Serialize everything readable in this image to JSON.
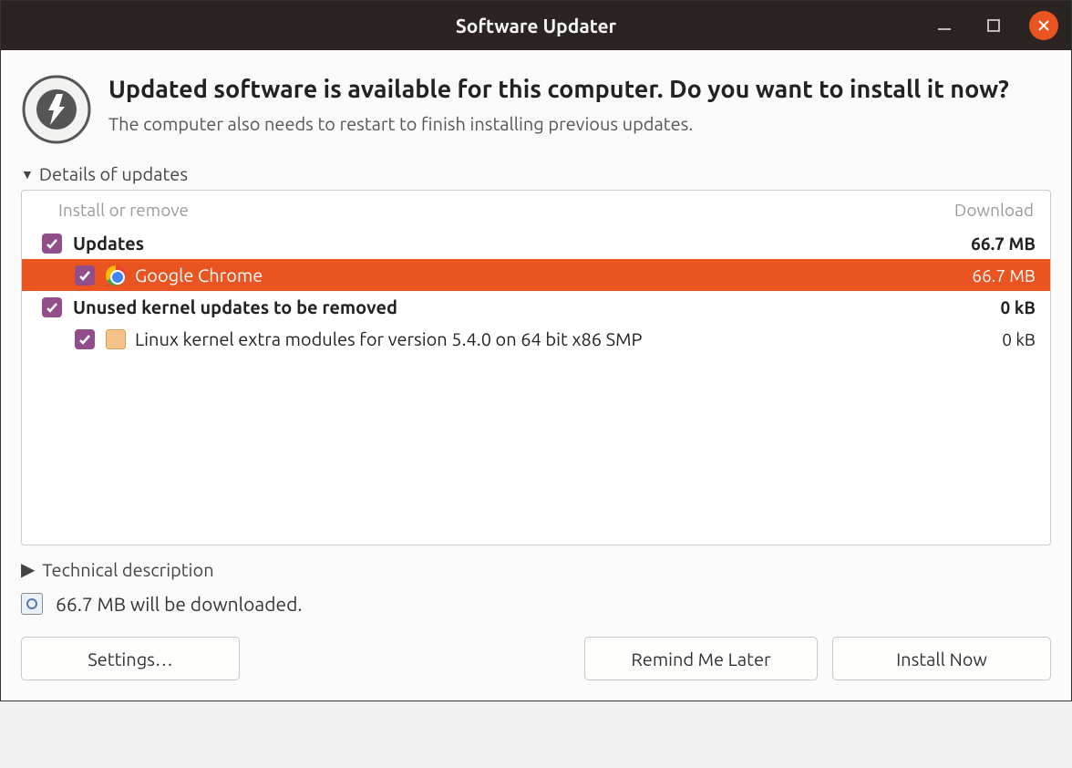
{
  "window": {
    "title": "Software Updater"
  },
  "header": {
    "heading": "Updated software is available for this computer. Do you want to install it now?",
    "subtext": "The computer also needs to restart to finish installing previous updates."
  },
  "details": {
    "expander_label": "Details of updates",
    "col_install": "Install or remove",
    "col_download": "Download",
    "groups": [
      {
        "label": "Updates",
        "size": "66.7 MB",
        "items": [
          {
            "label": "Google Chrome",
            "size": "66.7 MB",
            "icon": "chrome",
            "selected": true
          }
        ]
      },
      {
        "label": "Unused kernel updates to be removed",
        "size": "0 kB",
        "items": [
          {
            "label": "Linux kernel extra modules for version 5.4.0 on 64 bit x86 SMP",
            "size": "0 kB",
            "icon": "pkg",
            "selected": false
          }
        ]
      }
    ]
  },
  "technical_label": "Technical description",
  "download_summary": "66.7 MB will be downloaded.",
  "buttons": {
    "settings": "Settings…",
    "remind": "Remind Me Later",
    "install": "Install Now"
  }
}
